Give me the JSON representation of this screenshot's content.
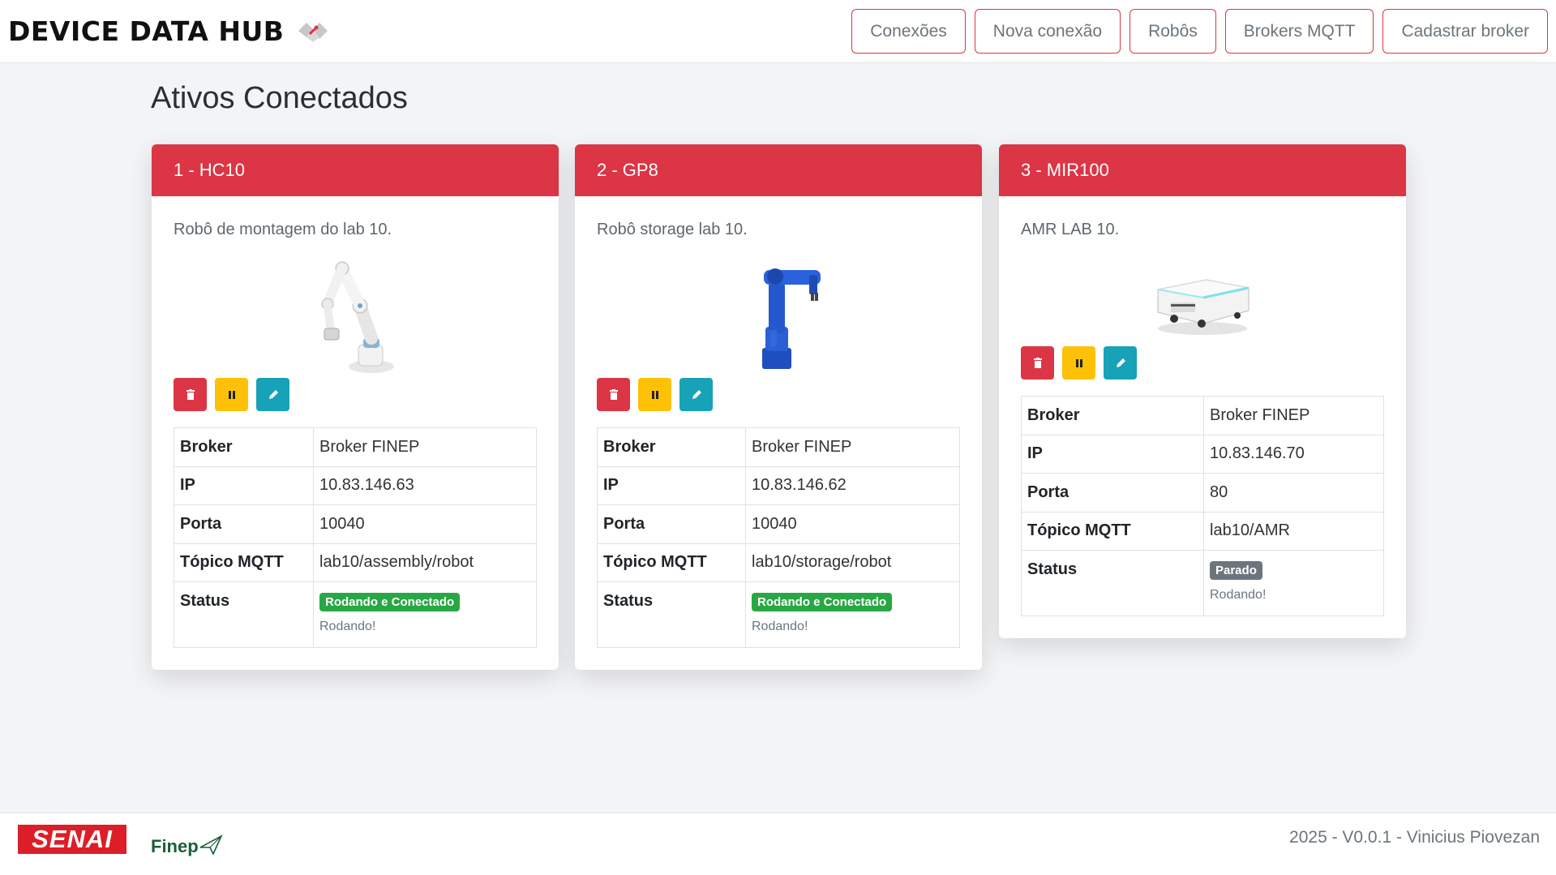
{
  "header": {
    "brand": "DEVICE DATA HUB",
    "nav": [
      "Conexões",
      "Nova conexão",
      "Robôs",
      "Brokers MQTT",
      "Cadastrar broker"
    ]
  },
  "main": {
    "title": "Ativos Conectados",
    "labels": {
      "broker": "Broker",
      "ip": "IP",
      "port": "Porta",
      "topic": "Tópico MQTT",
      "status": "Status"
    },
    "cards": [
      {
        "title": "1 - HC10",
        "description": "Robô de montagem do lab 10.",
        "broker": "Broker FINEP",
        "ip": "10.83.146.63",
        "port": "10040",
        "topic": "lab10/assembly/robot",
        "status_badge": "Rodando e Conectado",
        "status_text": "Rodando!"
      },
      {
        "title": "2 - GP8",
        "description": "Robô storage lab 10.",
        "broker": "Broker FINEP",
        "ip": "10.83.146.62",
        "port": "10040",
        "topic": "lab10/storage/robot",
        "status_badge": "Rodando e Conectado",
        "status_text": "Rodando!"
      },
      {
        "title": "3 - MIR100",
        "description": "AMR LAB 10.",
        "broker": "Broker FINEP",
        "ip": "10.83.146.70",
        "port": "80",
        "topic": "lab10/AMR",
        "status_badge": "Parado",
        "status_text": "Rodando!"
      }
    ]
  },
  "footer": {
    "senai": "SENAI",
    "finep": "Finep",
    "copyright": "2025 - V0.0.1 - Vinicius Piovezan"
  },
  "colors": {
    "accent": "#dc3545",
    "warning": "#ffc107",
    "info": "#17a2b8",
    "success": "#28a745",
    "secondary": "#6c757d"
  },
  "icons": [
    "trash-icon",
    "pause-icon",
    "pencil-icon"
  ]
}
